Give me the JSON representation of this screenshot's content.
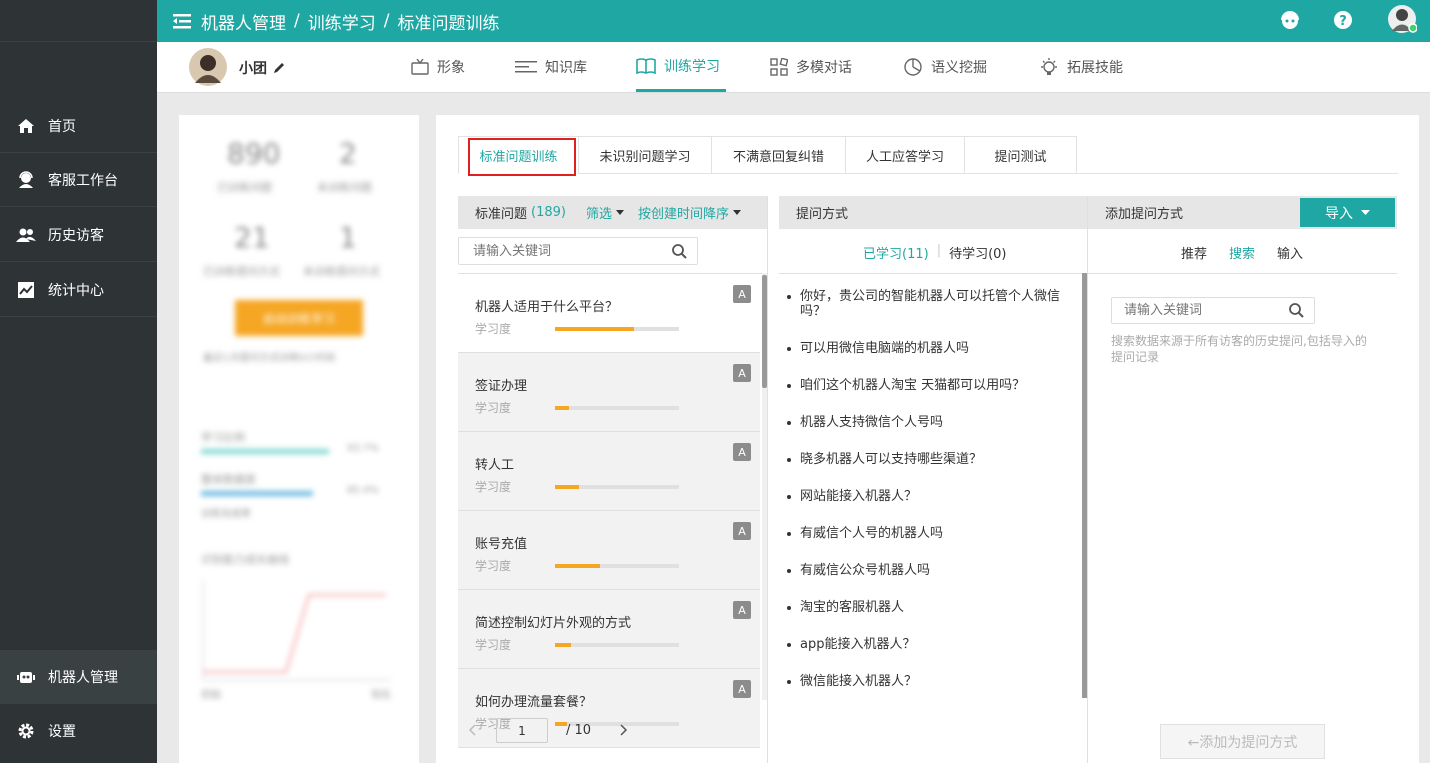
{
  "sidebar": {
    "items": [
      {
        "label": "首页",
        "icon": "home-icon"
      },
      {
        "label": "客服工作台",
        "icon": "agent-icon"
      },
      {
        "label": "历史访客",
        "icon": "users-icon"
      },
      {
        "label": "统计中心",
        "icon": "chart-icon"
      },
      {
        "label": "机器人管理",
        "icon": "robot-icon"
      },
      {
        "label": "设置",
        "icon": "gear-icon"
      }
    ]
  },
  "topbar": {
    "crumb1": "机器人管理",
    "crumb2": "训练学习",
    "crumb3": "标准问题训练",
    "sep": "/"
  },
  "robot": {
    "name": "小团"
  },
  "main_tabs": [
    "形象",
    "知识库",
    "训练学习",
    "多模对话",
    "语义挖掘",
    "拓展技能"
  ],
  "stats": {
    "v1": "890",
    "l1": "已训练问题",
    "v2": "2",
    "l2": "未训练问题",
    "v3": "21",
    "l3": "已训练提问方式",
    "v4": "1",
    "l4": "未训练提问方式",
    "btn": "启动训练学习",
    "note": "最近1次提问方式训练0小时前",
    "p1": "学习比例",
    "p1v": "93.7%",
    "p2": "整体数据度",
    "p2v": "85.4%",
    "p3": "训练完成率",
    "chart": "识别能力成长曲线",
    "x0": "初始",
    "x1": "现在"
  },
  "subtabs": [
    "标准问题训练",
    "未识别问题学习",
    "不满意回复纠错",
    "人工应答学习",
    "提问测试"
  ],
  "col1": {
    "title": "标准问题",
    "count": "(189)",
    "filter": "筛选",
    "sort": "按创建时间降序",
    "search_placeholder": "请输入关键词"
  },
  "questions": [
    {
      "title": "机器人适用于什么平台？",
      "label": "学习度",
      "badge": "A",
      "progress": 0.64
    },
    {
      "title": "签证办理",
      "label": "学习度",
      "badge": "A",
      "progress": 0.11
    },
    {
      "title": "转人工",
      "label": "学习度",
      "badge": "A",
      "progress": 0.19
    },
    {
      "title": "账号充值",
      "label": "学习度",
      "badge": "A",
      "progress": 0.36
    },
    {
      "title": "简述控制幻灯片外观的方式",
      "label": "学习度",
      "badge": "A",
      "progress": 0.13
    },
    {
      "title": "如何办理流量套餐？",
      "label": "学习度",
      "badge": "A",
      "progress": 0.1
    }
  ],
  "pager": {
    "page": "1",
    "total": "/ 10"
  },
  "col2": {
    "title": "提问方式",
    "learned": "已学习(11)",
    "pending": "待学习(0)",
    "sep": "|"
  },
  "answers": [
    "你好，贵公司的智能机器人可以托管个人微信吗？",
    "可以用微信电脑端的机器人吗",
    "咱们这个机器人淘宝 天猫都可以用吗？",
    "机器人支持微信个人号吗",
    "晓多机器人可以支持哪些渠道？",
    "网站能接入机器人？",
    "有威信个人号的机器人吗",
    "有威信公众号机器人吗",
    "淘宝的客服机器人",
    "app能接入机器人？",
    "微信能接入机器人？"
  ],
  "col3": {
    "title": "添加提问方式",
    "import_btn": "导入",
    "tabs": [
      "推荐",
      "搜索",
      "输入"
    ],
    "search_placeholder": "请输入关键词",
    "hint": "搜索数据来源于所有访客的历史提问,包括导入的提问记录",
    "add_btn": "←添加为提问方式"
  },
  "colors": {
    "accent": "#1fa8a3",
    "progress": "#f5a623",
    "highlight_border": "#e02020"
  }
}
